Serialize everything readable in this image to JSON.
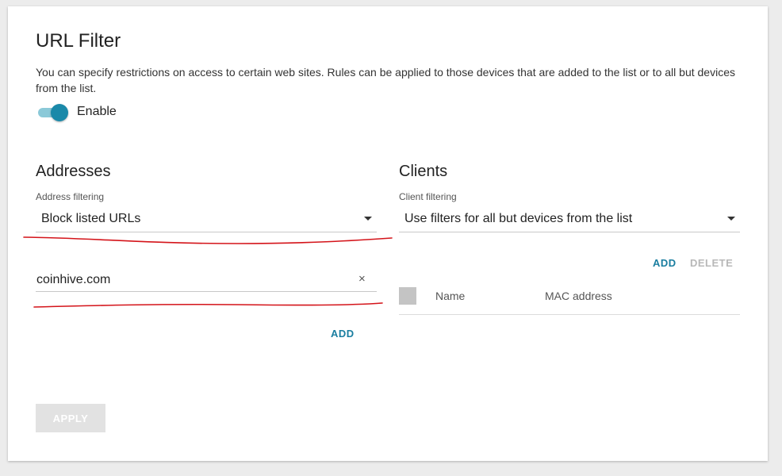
{
  "page": {
    "title": "URL Filter",
    "description": "You can specify restrictions on access to certain web sites. Rules can be applied to those devices that are added to the list or to all but devices from the list.",
    "enable_label": "Enable",
    "enable_on": true
  },
  "addresses": {
    "title": "Addresses",
    "filter_label": "Address filtering",
    "filter_value": "Block listed URLs",
    "url_value": "coinhive.com",
    "clear_icon": "×",
    "add_label": "ADD"
  },
  "clients": {
    "title": "Clients",
    "filter_label": "Client filtering",
    "filter_value": "Use filters for all but devices from the list",
    "add_label": "ADD",
    "delete_label": "DELETE",
    "columns": [
      "Name",
      "MAC address"
    ]
  },
  "footer": {
    "apply_label": "APPLY"
  },
  "colors": {
    "accent": "#1a89a9",
    "annotation": "#d4141a"
  },
  "icons": {
    "clear": "close-icon",
    "dropdown": "caret-down-icon"
  }
}
